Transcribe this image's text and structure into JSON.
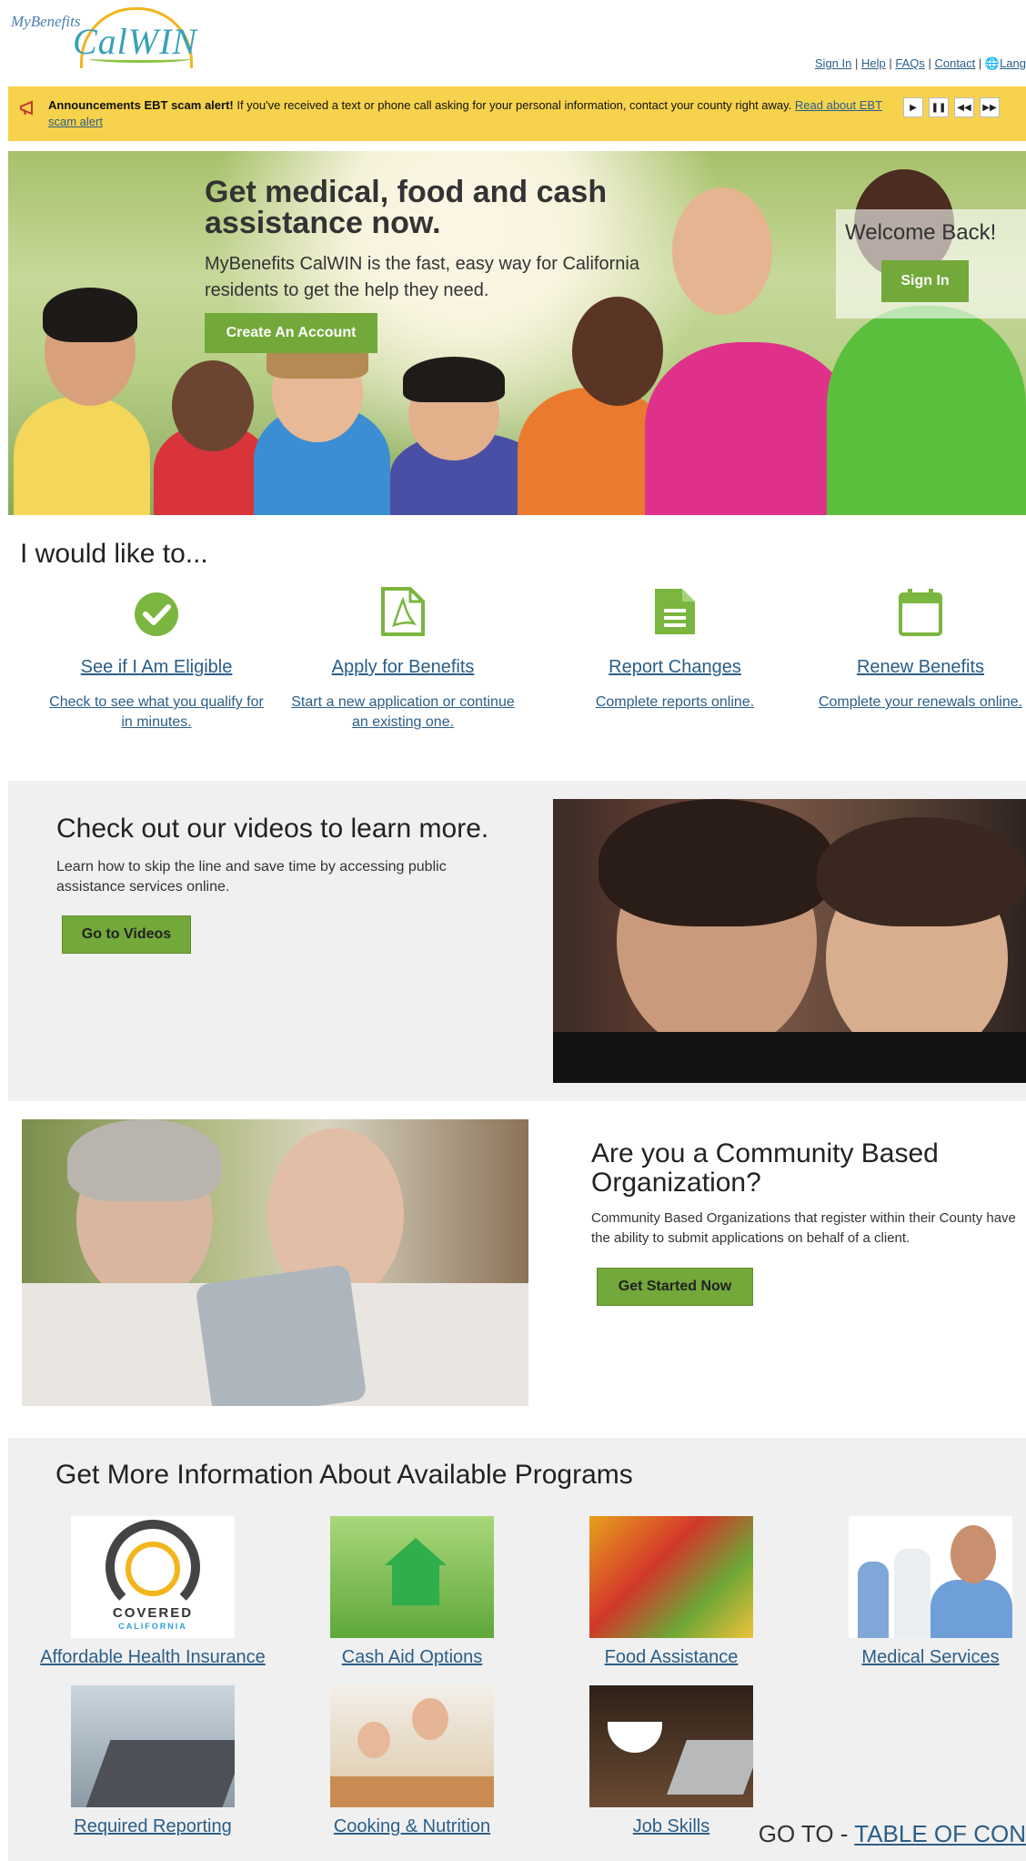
{
  "header": {
    "logo_text_1": "MyBenefits",
    "logo_text_2": "CalWIN",
    "links": [
      "Sign In",
      "Help",
      "FAQs",
      "Contact",
      "Lang"
    ]
  },
  "announcement": {
    "label": "Announcements",
    "title": "EBT scam alert!",
    "text": " If you've received a text or phone call asking for your personal information, contact your county right away. ",
    "link": "Read about EBT scam alert",
    "controls": [
      "play-icon",
      "pause-icon",
      "previous-icon",
      "next-icon"
    ]
  },
  "hero": {
    "title": "Get medical, food and cash assistance now.",
    "subtitle": "MyBenefits CalWIN is the fast, easy way for California residents to get the help they need.",
    "create_button": "Create An Account",
    "welcome_title": "Welcome Back!",
    "sign_in_button": "Sign In"
  },
  "actions": {
    "title": "I would like to...",
    "items": [
      {
        "label": "See if I Am Eligible",
        "desc": "Check to see what you qualify for in minutes.",
        "icon": "check-circle-icon"
      },
      {
        "label": "Apply for Benefits",
        "desc": "Start a new application or continue an existing one.",
        "icon": "pdf-file-icon"
      },
      {
        "label": "Report Changes",
        "desc": "Complete reports online.",
        "icon": "document-icon"
      },
      {
        "label": "Renew Benefits",
        "desc": "Complete your renewals online.",
        "icon": "calendar-icon"
      }
    ]
  },
  "videos": {
    "title": "Check out our videos to learn more.",
    "text": "Learn how to skip the line and save time by accessing public assistance services online.",
    "button": "Go to Videos"
  },
  "cbo": {
    "title": "Are you a Community Based Organization?",
    "text": "Community Based Organizations that register within their County have the ability to submit applications on behalf of a client.",
    "button": "Get Started Now"
  },
  "programs": {
    "title": "Get More Information About Available Programs",
    "covered_logo_1": "COVERED",
    "covered_logo_2": "CALIFORNIA",
    "items": [
      {
        "label": "Affordable Health Insurance"
      },
      {
        "label": "Cash Aid Options"
      },
      {
        "label": "Food Assistance"
      },
      {
        "label": "Medical Services"
      },
      {
        "label": "Required Reporting"
      },
      {
        "label": "Cooking & Nutrition"
      },
      {
        "label": "Job Skills"
      }
    ]
  },
  "goto": {
    "prefix": "GO TO - ",
    "link": "TABLE OF CON"
  },
  "colors": {
    "accent_green": "#73a83a",
    "announcement_yellow": "#f7d24c",
    "link_blue": "#2b5e87"
  }
}
